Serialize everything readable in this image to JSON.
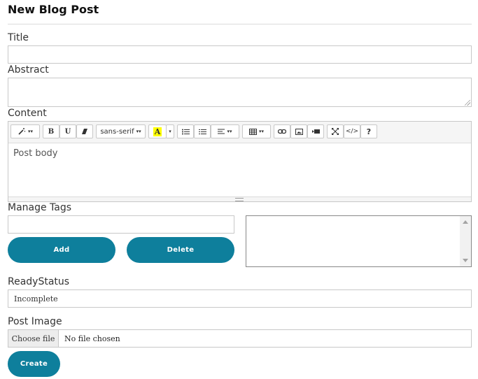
{
  "page": {
    "title": "New Blog Post"
  },
  "form": {
    "title_label": "Title",
    "title_value": "",
    "abstract_label": "Abstract",
    "abstract_value": "",
    "content_label": "Content",
    "manage_tags_label": "Manage Tags",
    "tag_input_value": "",
    "add_button": "Add",
    "delete_button": "Delete",
    "ready_status_label": "ReadyStatus",
    "ready_status_value": "Incomplete",
    "post_image_label": "Post Image",
    "choose_file_button": "Choose file",
    "file_status": "No file chosen",
    "create_button": "Create"
  },
  "editor": {
    "body_placeholder": "Post body",
    "toolbar": {
      "style_icon": "magic-wand-icon",
      "bold": "B",
      "underline": "U",
      "clear_format_icon": "eraser-icon",
      "font_name": "sans-serif",
      "font_color_letter": "A",
      "unordered_list_icon": "unordered-list-icon",
      "ordered_list_icon": "ordered-list-icon",
      "paragraph_icon": "align-left-icon",
      "table_icon": "table-icon",
      "link_icon": "link-icon",
      "picture_icon": "picture-icon",
      "video_icon": "video-icon",
      "fullscreen_icon": "fullscreen-icon",
      "codeview": "</>",
      "help": "?"
    }
  },
  "colors": {
    "accent": "#0e7f9c",
    "highlight": "#ffff00"
  }
}
